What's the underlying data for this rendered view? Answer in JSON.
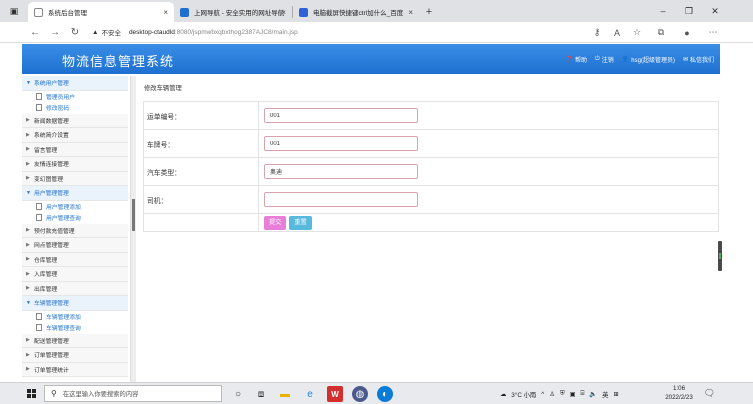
{
  "browser": {
    "tabs": [
      {
        "title": "系统后台管理",
        "active": true,
        "favicon_color": "#ffffff"
      },
      {
        "title": "上网导航 - 安全实用的网址导航",
        "active": false,
        "favicon_color": "#1e6fd0"
      },
      {
        "title": "电脑截屏快捷键ctrl加什么_百度",
        "active": false,
        "favicon_color": "#3060d8"
      }
    ],
    "insecure_label": "不安全",
    "url_host": "desktop-ctaudld",
    "url_path": ":8080/jspmwbxqbxthog2387AJC8/main.jsp"
  },
  "header": {
    "title": "物流信息管理系统",
    "links": [
      {
        "icon": "question-icon",
        "label": "帮助"
      },
      {
        "icon": "power-icon",
        "label": "注销"
      },
      {
        "icon": "user-icon",
        "label": "hsg(超级管理员)"
      },
      {
        "icon": "mail-icon",
        "label": "私信我们"
      }
    ]
  },
  "sidebar": {
    "items": [
      {
        "type": "group",
        "label": "系统用户管理",
        "open": true
      },
      {
        "type": "sub",
        "label": "管理员用户"
      },
      {
        "type": "sub",
        "label": "修改密码"
      },
      {
        "type": "group",
        "label": "新闻数据管理",
        "open": false
      },
      {
        "type": "group",
        "label": "系统简介设置",
        "open": false
      },
      {
        "type": "group",
        "label": "留言管理",
        "open": false
      },
      {
        "type": "group",
        "label": "友情连接管理",
        "open": false
      },
      {
        "type": "group",
        "label": "变幻图管理",
        "open": false
      },
      {
        "type": "group",
        "label": "用户管理管理",
        "open": true
      },
      {
        "type": "sub",
        "label": "用户管理添加"
      },
      {
        "type": "sub",
        "label": "用户管理查询"
      },
      {
        "type": "group",
        "label": "预付款充值管理",
        "open": false
      },
      {
        "type": "group",
        "label": "网点管理管理",
        "open": false
      },
      {
        "type": "group",
        "label": "仓库管理",
        "open": false
      },
      {
        "type": "group",
        "label": "入库管理",
        "open": false
      },
      {
        "type": "group",
        "label": "出库管理",
        "open": false
      },
      {
        "type": "group",
        "label": "车辆管理管理",
        "open": true
      },
      {
        "type": "sub",
        "label": "车辆管理添加"
      },
      {
        "type": "sub",
        "label": "车辆管理查询"
      },
      {
        "type": "group",
        "label": "配送管理管理",
        "open": false
      },
      {
        "type": "group",
        "label": "订单管理管理",
        "open": false
      },
      {
        "type": "group",
        "label": "订单管理统计",
        "open": false
      }
    ]
  },
  "form": {
    "panel_title": "修改车辆管理",
    "fields": [
      {
        "label": "运单编号：",
        "value": "001"
      },
      {
        "label": "车牌号：",
        "value": "001"
      },
      {
        "label": "汽车类型：",
        "value": "奥迪"
      },
      {
        "label": "司机：",
        "value": ""
      }
    ],
    "submit_label": "提交",
    "reset_label": "重置"
  },
  "taskbar": {
    "search_placeholder": "在这里输入你要搜索的内容",
    "weather": "3°C 小雨",
    "ime": "英",
    "time": "1:06",
    "date": "2022/2/23"
  }
}
